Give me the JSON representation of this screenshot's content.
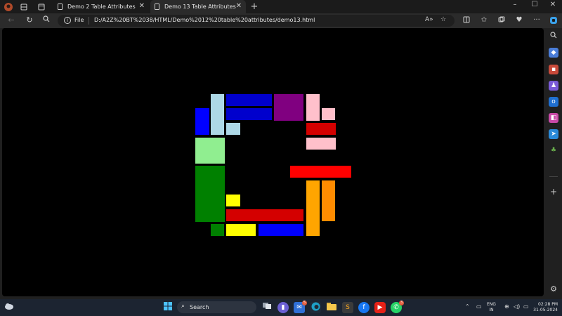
{
  "tabs": [
    {
      "title": "Demo 2 Table Attributes",
      "active": false
    },
    {
      "title": "Demo 13 Table Attributes",
      "active": true
    }
  ],
  "toolbar": {
    "new_tab_symbol": "+",
    "minimize": "–",
    "maximize": "☐",
    "close": "✕"
  },
  "address": {
    "scheme_label": "File",
    "url": "D:/A2Z%20BT%2038/HTML/Demo%2012%20table%20attributes/demo13.html"
  },
  "icons": [
    "profile-icon",
    "workspaces-icon",
    "tab-actions-icon",
    "back-icon",
    "refresh-icon",
    "search-icon",
    "info-icon",
    "read-aloud-icon",
    "favorite-star-icon",
    "split-screen-icon",
    "favorites-icon",
    "collections-icon",
    "browser-essentials-icon",
    "more-icon",
    "copilot-icon"
  ],
  "sidebar": [
    {
      "name": "search-icon",
      "color": "#202020"
    },
    {
      "name": "shopping-tag-icon",
      "color": "#4a7dd8"
    },
    {
      "name": "tools-briefcase-icon",
      "color": "#c84a3a"
    },
    {
      "name": "games-icon",
      "color": "#7a5ad8"
    },
    {
      "name": "outlook-icon",
      "color": "#1f6fd0"
    },
    {
      "name": "office-icon",
      "color": "#c94aa8"
    },
    {
      "name": "send-icon",
      "color": "#2a8ad8"
    },
    {
      "name": "tree-icon",
      "color": "#6ab04c"
    },
    {
      "name": "add-icon",
      "color": "#202020"
    },
    {
      "name": "settings-icon",
      "color": "#202020"
    }
  ],
  "shapes": [
    {
      "id": "lightblue-top",
      "color": "#add8e6"
    },
    {
      "id": "blue-left",
      "color": "#0000ff"
    },
    {
      "id": "blue-top-1",
      "color": "#0000cd"
    },
    {
      "id": "blue-top-2",
      "color": "#0000cd"
    },
    {
      "id": "lightblue-small",
      "color": "#add8e6"
    },
    {
      "id": "purple",
      "color": "#800080"
    },
    {
      "id": "pink-tall",
      "color": "#ffc0cb"
    },
    {
      "id": "pink-small",
      "color": "#ffc0cb"
    },
    {
      "id": "red-small",
      "color": "#d40000"
    },
    {
      "id": "pink-wide",
      "color": "#ffc0cb"
    },
    {
      "id": "lightgreen",
      "color": "#90ee90"
    },
    {
      "id": "red-wide",
      "color": "#ff0000"
    },
    {
      "id": "green-tall",
      "color": "#008000"
    },
    {
      "id": "orange-1",
      "color": "#ffa500"
    },
    {
      "id": "orange-2",
      "color": "#ff8c00"
    },
    {
      "id": "yellow-small",
      "color": "#ffff00"
    },
    {
      "id": "red-bottom",
      "color": "#d40000"
    },
    {
      "id": "green-small",
      "color": "#008000"
    },
    {
      "id": "yellow-bottom",
      "color": "#ffff00"
    },
    {
      "id": "blue-bottom",
      "color": "#0000ff"
    }
  ],
  "taskbar": {
    "search_label": "Search",
    "lang_top": "ENG",
    "lang_bottom": "IN",
    "time": "02:28 PM",
    "date": "31-05-2024",
    "mail_badge": "5",
    "whatsapp_badge": "3"
  }
}
